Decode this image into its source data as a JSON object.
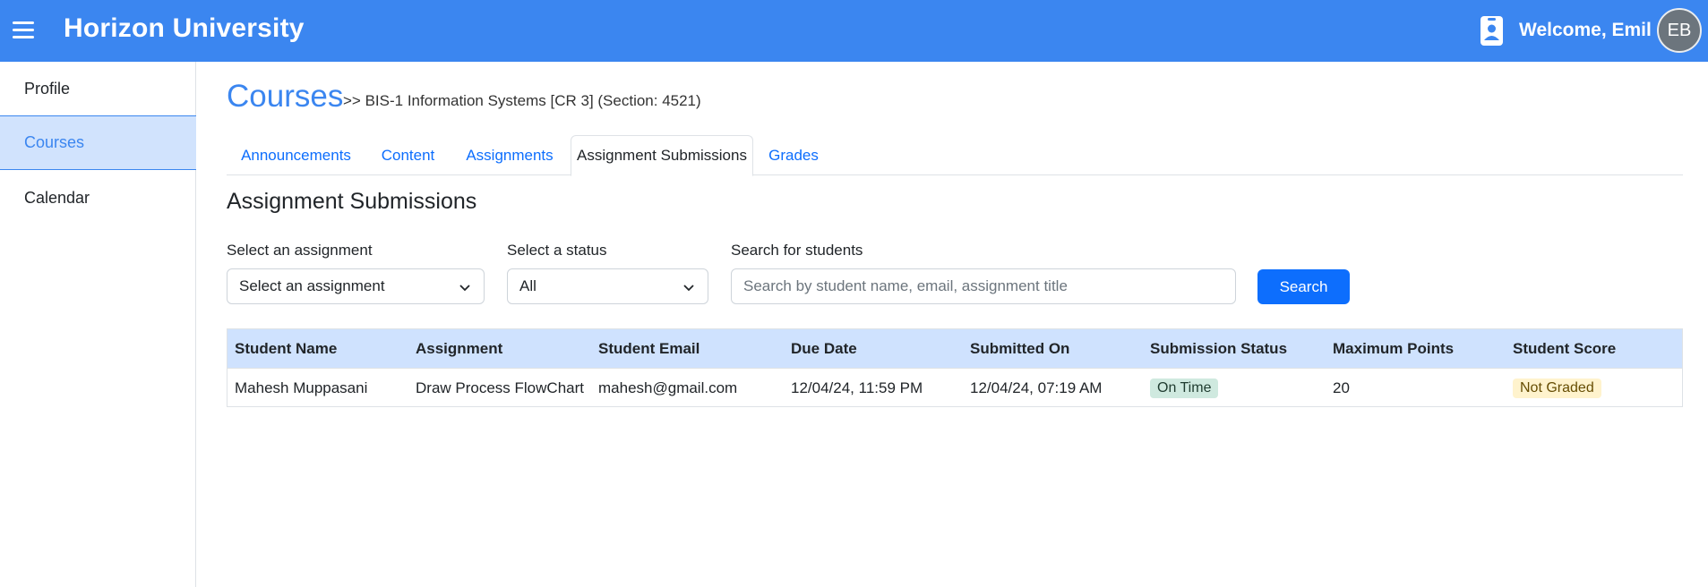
{
  "header": {
    "brand": "Horizon University",
    "welcome": "Welcome, Emil",
    "avatar_initials": "EB",
    "menu_icon": "hamburger-menu-icon",
    "badge_icon": "id-badge-icon"
  },
  "sidebar": {
    "items": [
      {
        "label": "Profile"
      },
      {
        "label": "Courses",
        "active": true
      },
      {
        "label": "Calendar"
      }
    ]
  },
  "main": {
    "title": "Courses",
    "breadcrumb": ">> BIS-1 Information Systems [CR 3] (Section: 4521)",
    "tabs": [
      {
        "label": "Announcements"
      },
      {
        "label": "Content"
      },
      {
        "label": "Assignments"
      },
      {
        "label": "Assignment Submissions",
        "active": true
      },
      {
        "label": "Grades"
      }
    ],
    "section_title": "Assignment Submissions"
  },
  "filters": {
    "assignment_label": "Select an assignment",
    "assignment_value": "Select an assignment",
    "status_label": "Select a status",
    "status_value": "All",
    "search_label": "Search for students",
    "search_placeholder": "Search by student name, email, assignment title",
    "search_button": "Search"
  },
  "table": {
    "headers": [
      "Student Name",
      "Assignment",
      "Student Email",
      "Due Date",
      "Submitted On",
      "Submission Status",
      "Maximum Points",
      "Student Score"
    ],
    "rows": [
      {
        "student_name": "Mahesh Muppasani",
        "assignment": "Draw Process FlowChart",
        "email": "mahesh@gmail.com",
        "due_date": "12/04/24, 11:59 PM",
        "submitted_on": "12/04/24, 07:19 AM",
        "status": "On Time",
        "max_points": "20",
        "score": "Not Graded"
      }
    ]
  },
  "colors": {
    "primary": "#3b86f0",
    "button": "#0d6efd",
    "table_header": "#cfe2fe",
    "status_ontime": "#cfe9df",
    "status_notgraded": "#fff3cd"
  }
}
